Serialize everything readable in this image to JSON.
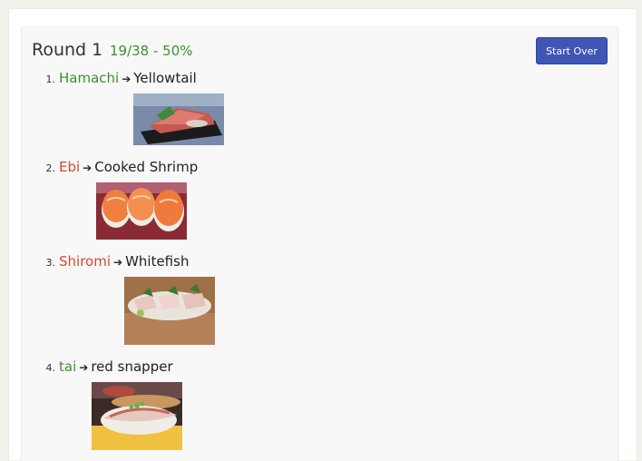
{
  "round": {
    "title": "Round 1",
    "score": "19/38 - 50%"
  },
  "buttons": {
    "start_over": "Start Over"
  },
  "items": [
    {
      "num": "1.",
      "word": "Hamachi",
      "arrow": "➔",
      "meaning": "Yellowtail",
      "status": "correct",
      "image": "hamachi-sashimi-photo"
    },
    {
      "num": "2.",
      "word": "Ebi",
      "arrow": "➔",
      "meaning": "Cooked Shrimp",
      "status": "wrong",
      "image": "ebi-nigiri-photo"
    },
    {
      "num": "3.",
      "word": "Shiromi",
      "arrow": "➔",
      "meaning": "Whitefish",
      "status": "wrong",
      "image": "shiromi-sashimi-photo"
    },
    {
      "num": "4.",
      "word": "tai",
      "arrow": "➔",
      "meaning": "red snapper",
      "status": "correct",
      "image": "tai-nigiri-photo"
    }
  ],
  "colors": {
    "correct": "#3f8f2f",
    "wrong": "#d44a2e",
    "button": "#3f56b5"
  }
}
